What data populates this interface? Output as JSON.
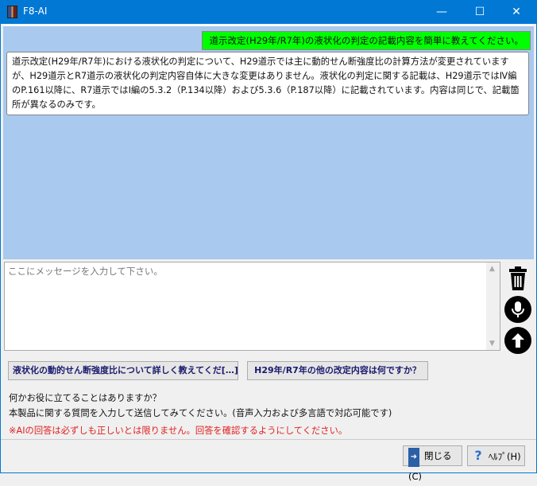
{
  "window": {
    "title": "F8-AI",
    "minimize": "—",
    "maximize": "☐",
    "close": "✕"
  },
  "chat": {
    "user_message": "道示改定(H29年/R7年)の液状化の判定の記載内容を簡単に教えてください。",
    "ai_message": "道示改定(H29年/R7年)における液状化の判定について、H29道示では主に動的せん断強度比の計算方法が変更されていますが、H29道示とR7道示の液状化の判定内容自体に大きな変更はありません。液状化の判定に関する記載は、H29道示ではⅣ編のP.161以降に、R7道示ではⅠ編の5.3.2（P.134以降）および5.3.6（P.187以降）に記載されています。内容は同じで、記載箇所が異なるのみです。"
  },
  "input": {
    "placeholder": "ここにメッセージを入力して下さい。",
    "value": ""
  },
  "side_icons": [
    "trash-icon",
    "microphone-icon",
    "send-arrow-up-icon"
  ],
  "suggestions": [
    "液状化の動的せん断強度比について詳しく教えてくだ[…]",
    "H29年/R7年の他の改定内容は何ですか？"
  ],
  "info": {
    "line1": "何かお役に立てることはありますか？",
    "line2": "本製品に関する質問を入力して送信してみてください。(音声入力および多言語で対応可能です)",
    "warning": "※AIの回答は必ずしも正しいとは限りません。回答を確認するようにしてください。"
  },
  "footer": {
    "close_label": "閉じる(C)",
    "help_label": "ﾍﾙﾌﾟ(H)"
  },
  "colors": {
    "titlebar": "#0078d4",
    "chat_bg": "#a9c9ef",
    "user_bubble": "#00ff00",
    "warning": "#e02020"
  }
}
